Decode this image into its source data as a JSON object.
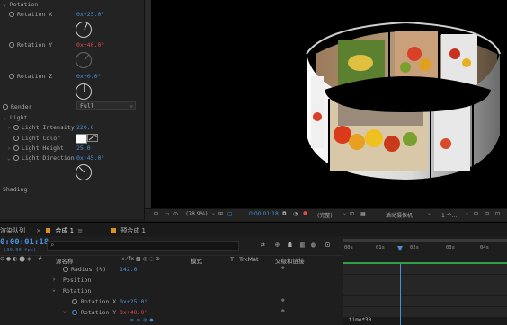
{
  "effects_panel": {
    "section_rotation": "Rotation",
    "rotation_x": {
      "label": "Rotation X",
      "value": "0x+25.0°"
    },
    "rotation_y": {
      "label": "Rotation Y",
      "value": "0x+40.0°"
    },
    "rotation_z": {
      "label": "Rotation Z",
      "value": "0x+0.0°"
    },
    "render": {
      "label": "Render",
      "value": "Full"
    },
    "section_light": "Light",
    "light_intensity": {
      "label": "Light Intensity",
      "value": "220.0"
    },
    "light_color": {
      "label": "Light Color",
      "color": "#ffffff"
    },
    "light_height": {
      "label": "Light Height",
      "value": "25.0"
    },
    "light_direction": {
      "label": "Light Direction",
      "value": "0x-45.0°"
    },
    "section_shading": "Shading"
  },
  "viewer_toolbar": {
    "zoom": "(78.9%)",
    "timecode": "0:00:01:18",
    "quality": "(完整)",
    "camera": "活动摄像机",
    "views": "1 个..."
  },
  "tabs": {
    "render_queue": "渲染队列",
    "comp1": "合成 1",
    "precomp1": "预合成 1"
  },
  "timeline": {
    "current_time": "0:00:01:18",
    "frame_info": "(30.00 fps)",
    "search_placeholder": "",
    "columns": {
      "layer_name": "源名称",
      "mode": "模式",
      "t": "T",
      "trkmat": "TrkMat",
      "parent": "父级和链接"
    },
    "ruler": [
      "00s",
      "01s",
      "02s",
      "03s",
      "04s"
    ],
    "rows": [
      {
        "label": "Radius (%)",
        "value": "142.0"
      },
      {
        "label": "Position",
        "value": ""
      },
      {
        "label": "Rotation",
        "value": ""
      },
      {
        "label": "Rotation X",
        "value": "0x+25.0°"
      },
      {
        "label": "Rotation Y",
        "value": "0x+40.0°"
      },
      {
        "label": "",
        "value": ""
      }
    ],
    "time_indicator": "time*30"
  },
  "colors": {
    "accent_blue": "#4a8fd8",
    "keyframe_red": "#d84a4a",
    "work_area_green": "#2f9e44"
  }
}
